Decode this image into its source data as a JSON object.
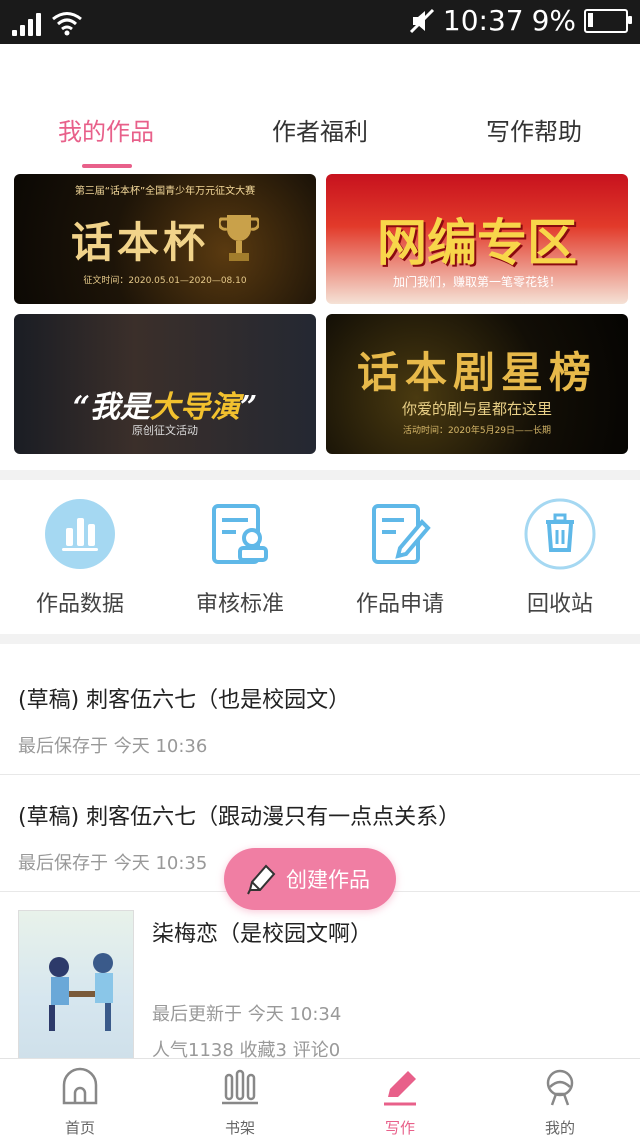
{
  "status_bar": {
    "time": "10:37",
    "battery": "9%"
  },
  "tabs": [
    {
      "label": "我的作品",
      "active": true
    },
    {
      "label": "作者福利",
      "active": false
    },
    {
      "label": "写作帮助",
      "active": false
    }
  ],
  "banners": {
    "b1": {
      "title": "话本杯",
      "subtitle": "第三届“话本杯”全国青少年万元征文大赛",
      "date": "征文时间：2020.05.01—2020—08.10"
    },
    "b2": {
      "title": "网编专区",
      "subtitle": "加门我们，赚取第一笔零花钱！"
    },
    "b3": {
      "title_prefix": "“我是",
      "title_highlight": "大导演",
      "title_suffix": "”",
      "subtitle": "原创征文活动"
    },
    "b4": {
      "title": "话本剧星榜",
      "subtitle": "你爱的剧与星都在这里",
      "date": "活动时间：2020年5月29日——长期"
    }
  },
  "tools": [
    {
      "label": "作品数据",
      "icon": "bar-chart-icon"
    },
    {
      "label": "审核标准",
      "icon": "review-standard-icon"
    },
    {
      "label": "作品申请",
      "icon": "edit-document-icon"
    },
    {
      "label": "回收站",
      "icon": "trash-icon"
    }
  ],
  "works": [
    {
      "title": "(草稿) 刺客伍六七（也是校园文）",
      "meta": "最后保存于 今天 10:36"
    },
    {
      "title": "(草稿) 刺客伍六七（跟动漫只有一点点关系）",
      "meta": "最后保存于 今天 10:35"
    },
    {
      "title": "柒梅恋（是校园文啊）",
      "meta": "最后更新于 今天 10:34",
      "stats": "人气1138  收藏3  评论0"
    }
  ],
  "fab": {
    "label": "创建作品"
  },
  "bottom_nav": [
    {
      "label": "首页",
      "icon": "home-icon"
    },
    {
      "label": "书架",
      "icon": "bookshelf-icon"
    },
    {
      "label": "写作",
      "icon": "pen-icon",
      "active": true
    },
    {
      "label": "我的",
      "icon": "profile-icon"
    }
  ],
  "colors": {
    "accent": "#e8608a",
    "fab": "#f07ea3",
    "icon_blue": "#5fb8e8"
  }
}
